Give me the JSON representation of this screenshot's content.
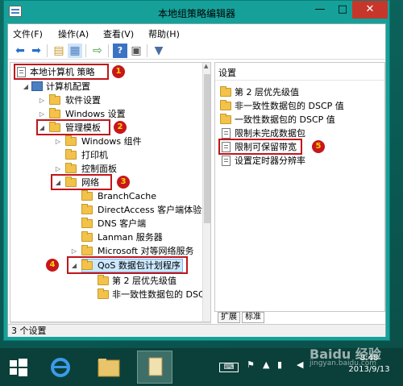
{
  "window": {
    "title": "本地组策略编辑器",
    "buttons": {
      "minimize": "—",
      "maximize": "□",
      "close": "✕"
    }
  },
  "menu": [
    "文件(F)",
    "操作(A)",
    "查看(V)",
    "帮助(H)"
  ],
  "toolbar_icons": [
    "back-icon",
    "forward-icon",
    "up-folder-icon",
    "show-tree-icon",
    "export-icon",
    "help-icon",
    "properties-icon",
    "filter-icon"
  ],
  "tree": [
    {
      "label": "本地计算机 策略",
      "level": 0,
      "badge": "1"
    },
    {
      "label": "计算机配置",
      "level": 1
    },
    {
      "label": "软件设置",
      "level": 2
    },
    {
      "label": "Windows 设置",
      "level": 2
    },
    {
      "label": "管理模板",
      "level": 2,
      "badge": "2"
    },
    {
      "label": "Windows 组件",
      "level": 3
    },
    {
      "label": "打印机",
      "level": 3
    },
    {
      "label": "控制面板",
      "level": 3
    },
    {
      "label": "网络",
      "level": 3,
      "badge": "3"
    },
    {
      "label": "BranchCache",
      "level": 4
    },
    {
      "label": "DirectAccess 客户端体验设",
      "level": 4
    },
    {
      "label": "DNS 客户端",
      "level": 4
    },
    {
      "label": "Lanman 服务器",
      "level": 4
    },
    {
      "label": "Microsoft 对等网络服务",
      "level": 4
    },
    {
      "label": "QoS 数据包计划程序",
      "level": 4,
      "badge": "4"
    },
    {
      "label": "第 2 层优先级值",
      "level": 5
    },
    {
      "label": "非一致性数据包的 DSC",
      "level": 5
    }
  ],
  "right": {
    "header": "设置",
    "items": [
      {
        "label": "第 2 层优先级值",
        "type": "folder"
      },
      {
        "label": "非一致性数据包的 DSCP 值",
        "type": "folder"
      },
      {
        "label": "一致性数据包的 DSCP 值",
        "type": "folder"
      },
      {
        "label": "限制未完成数据包",
        "type": "setting"
      },
      {
        "label": "限制可保留带宽",
        "type": "setting",
        "badge": "5"
      },
      {
        "label": "设置定时器分辨率",
        "type": "setting"
      }
    ],
    "tabs": [
      "扩展",
      "标准"
    ]
  },
  "status": "3 个设置",
  "taskbar": {
    "time": "8:48",
    "date": "2013/9/13",
    "watermark": "Baidu 经验",
    "watermark_sub": "jingyan.baidu.com"
  }
}
